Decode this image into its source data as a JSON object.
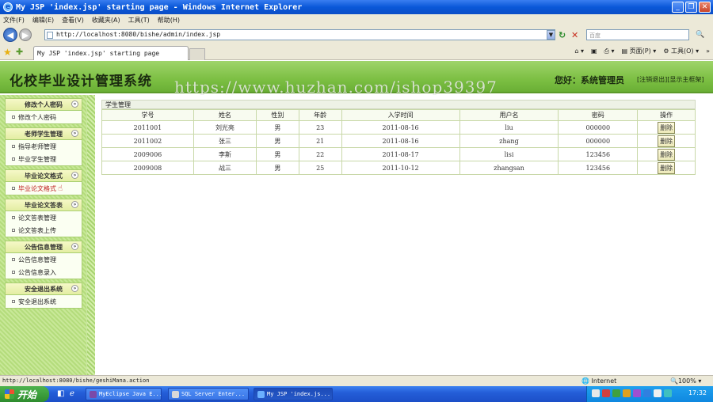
{
  "window": {
    "title": "My JSP 'index.jsp' starting page - Windows Internet Explorer",
    "icon": "ie-icon"
  },
  "menubar": [
    "文件(F)",
    "编辑(E)",
    "查看(V)",
    "收藏夹(A)",
    "工具(T)",
    "帮助(H)"
  ],
  "address": {
    "url": "http://localhost:8080/bishe/admin/index.jsp",
    "search_placeholder": "百度"
  },
  "tab": {
    "label": "My JSP 'index.jsp' starting page"
  },
  "ie_toolbar": {
    "page": "页面(P)",
    "tools": "工具(O)"
  },
  "header": {
    "title": "化校毕业设计管理系统",
    "greeting": "您好：系统管理员",
    "logout": "[注销退出]",
    "home": "[显示主框架]"
  },
  "watermark": "https://www.huzhan.com/ishop39397",
  "sidebar": [
    {
      "title": "修改个人密码",
      "items": [
        "修改个人密码"
      ]
    },
    {
      "title": "老师学生管理",
      "items": [
        "指导老师管理",
        "毕业学生管理"
      ]
    },
    {
      "title": "毕业论文格式",
      "items": [
        "毕业论文格式"
      ]
    },
    {
      "title": "毕业论文答表",
      "items": [
        "论文答表管理",
        "论文答表上传"
      ]
    },
    {
      "title": "公告信息管理",
      "items": [
        "公告信息管理",
        "公告信息录入"
      ]
    },
    {
      "title": "安全退出系统",
      "items": [
        "安全退出系统"
      ]
    }
  ],
  "panel": {
    "title": "学生管理"
  },
  "table": {
    "columns": [
      "学号",
      "姓名",
      "性别",
      "年龄",
      "入学时间",
      "用户名",
      "密码",
      "操作"
    ],
    "rows": [
      [
        "2011001",
        "刘光亮",
        "男",
        "23",
        "2011-08-16",
        "liu",
        "000000"
      ],
      [
        "2011002",
        "张三",
        "男",
        "21",
        "2011-08-16",
        "zhang",
        "000000"
      ],
      [
        "2009006",
        "李斯",
        "男",
        "22",
        "2011-08-17",
        "lisi",
        "123456"
      ],
      [
        "2009008",
        "战三",
        "男",
        "25",
        "2011-10-12",
        "zhangsan",
        "123456"
      ]
    ],
    "action_label": "删除"
  },
  "statusbar": {
    "text": "http://localhost:8080/bishe/geshiMana.action",
    "zone": "Internet",
    "zoom": "100%"
  },
  "taskbar": {
    "start": "开始",
    "tasks": [
      "MyEclipse Java E...",
      "SQL Server Enter...",
      "My JSP 'index.js..."
    ],
    "clock": "17:32"
  }
}
